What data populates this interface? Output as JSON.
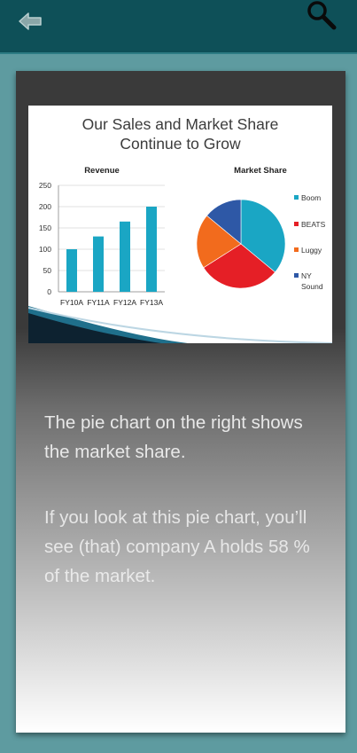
{
  "slide": {
    "title_line1": "Our Sales and Market Share",
    "title_line2": "Continue to Grow"
  },
  "chart_data": [
    {
      "type": "bar",
      "title": "Revenue",
      "categories": [
        "FY10A",
        "FY11A",
        "FY12A",
        "FY13A"
      ],
      "values": [
        100,
        130,
        165,
        200
      ],
      "ylim": [
        0,
        250
      ],
      "yticks": [
        0,
        50,
        100,
        150,
        200,
        250
      ],
      "color": "#1aa6c4",
      "grid": true
    },
    {
      "type": "pie",
      "title": "Market Share",
      "labels": [
        "Boom",
        "BEATS",
        "Luggy",
        "NY Sound"
      ],
      "values": [
        36,
        30,
        20,
        14
      ],
      "colors": [
        "#1aa6c4",
        "#e51f26",
        "#f26b1d",
        "#2e58a6"
      ],
      "legend_position": "right"
    }
  ],
  "caption": {
    "paragraph1": "The pie chart on the right shows the market share.",
    "paragraph2": "If you look at this pie chart, you’ll see (that) company A holds 58 % of the market."
  },
  "icons": {
    "back": "back-arrow-icon",
    "search": "search-icon"
  }
}
